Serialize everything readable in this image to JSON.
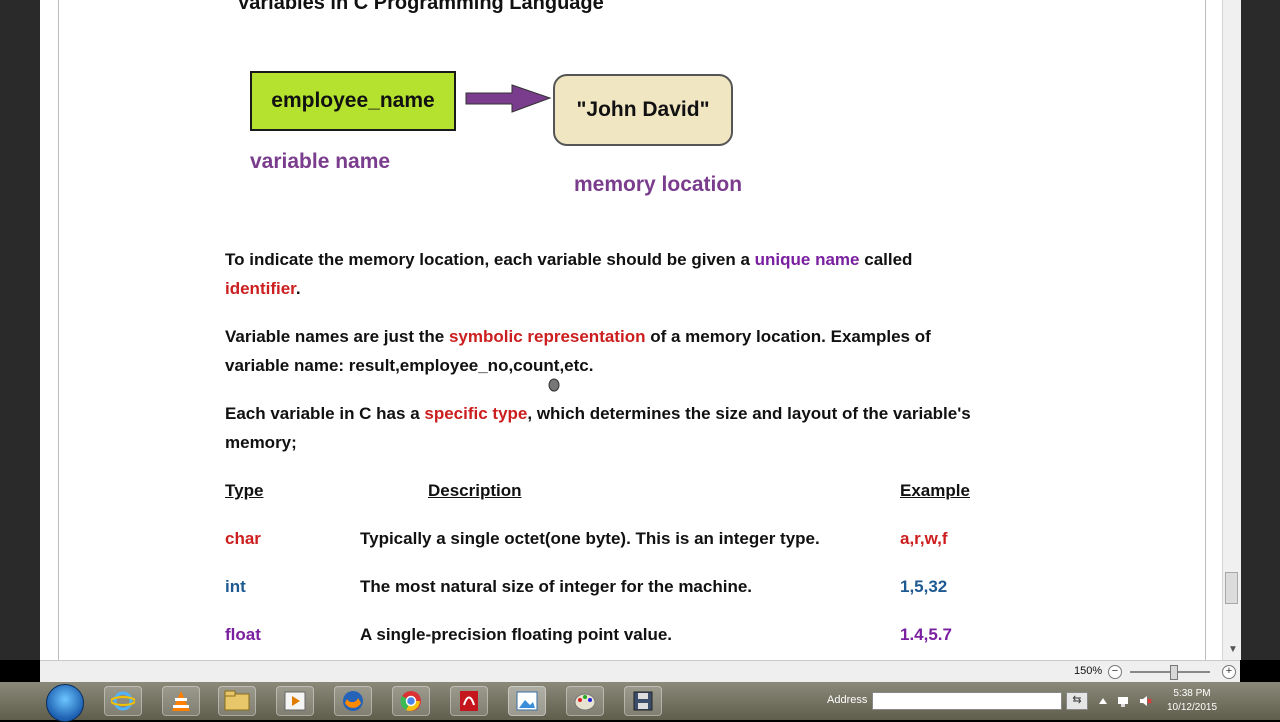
{
  "document": {
    "heading": "Variables in C Programming Language",
    "diagram": {
      "box1": "employee_name",
      "box2": "\"John David\"",
      "label1": "variable name",
      "label2": "memory location"
    },
    "p1": {
      "a": "To indicate the memory location, each variable should be given a ",
      "b": "unique name",
      "c": " called",
      "d": "identifier",
      "e": "."
    },
    "p2": {
      "a": "Variable names are just the ",
      "b": "symbolic representation",
      "c": " of a memory location. Examples of",
      "line2": "variable name: result,employee_no,count,etc."
    },
    "p3": {
      "a": "Each variable in C has a ",
      "b": "specific type",
      "c": ", which determines the size and layout of the variable's",
      "line2": "memory;"
    },
    "table": {
      "headers": {
        "type": "Type",
        "description": "Description",
        "example": "Example"
      },
      "rows": [
        {
          "type": "char",
          "description": "Typically a single octet(one byte). This is an integer type.",
          "example": "a,r,w,f"
        },
        {
          "type": "int",
          "description": "The most natural size of integer for the machine.",
          "example": "1,5,32"
        },
        {
          "type": "float",
          "description": "A single-precision floating point value.",
          "example": "1.4,5.7"
        }
      ]
    }
  },
  "statusbar": {
    "zoom": "150%",
    "zoom_minus": "−",
    "zoom_plus": "+"
  },
  "taskbar": {
    "address_label": "Address",
    "time": "5:38 PM",
    "date": "10/12/2015",
    "apps": [
      "internet-explorer",
      "vlc",
      "file-explorer",
      "media-player",
      "firefox",
      "chrome",
      "pdf-reader",
      "picture-viewer",
      "paint",
      "save-disk"
    ]
  },
  "colors": {
    "purple": "#7a3c8c",
    "red": "#cc1e1e",
    "violet": "#7a1fa0",
    "blue": "#1e5a92",
    "box_green": "#b5e22e",
    "box_cream": "#f0e6c2"
  }
}
